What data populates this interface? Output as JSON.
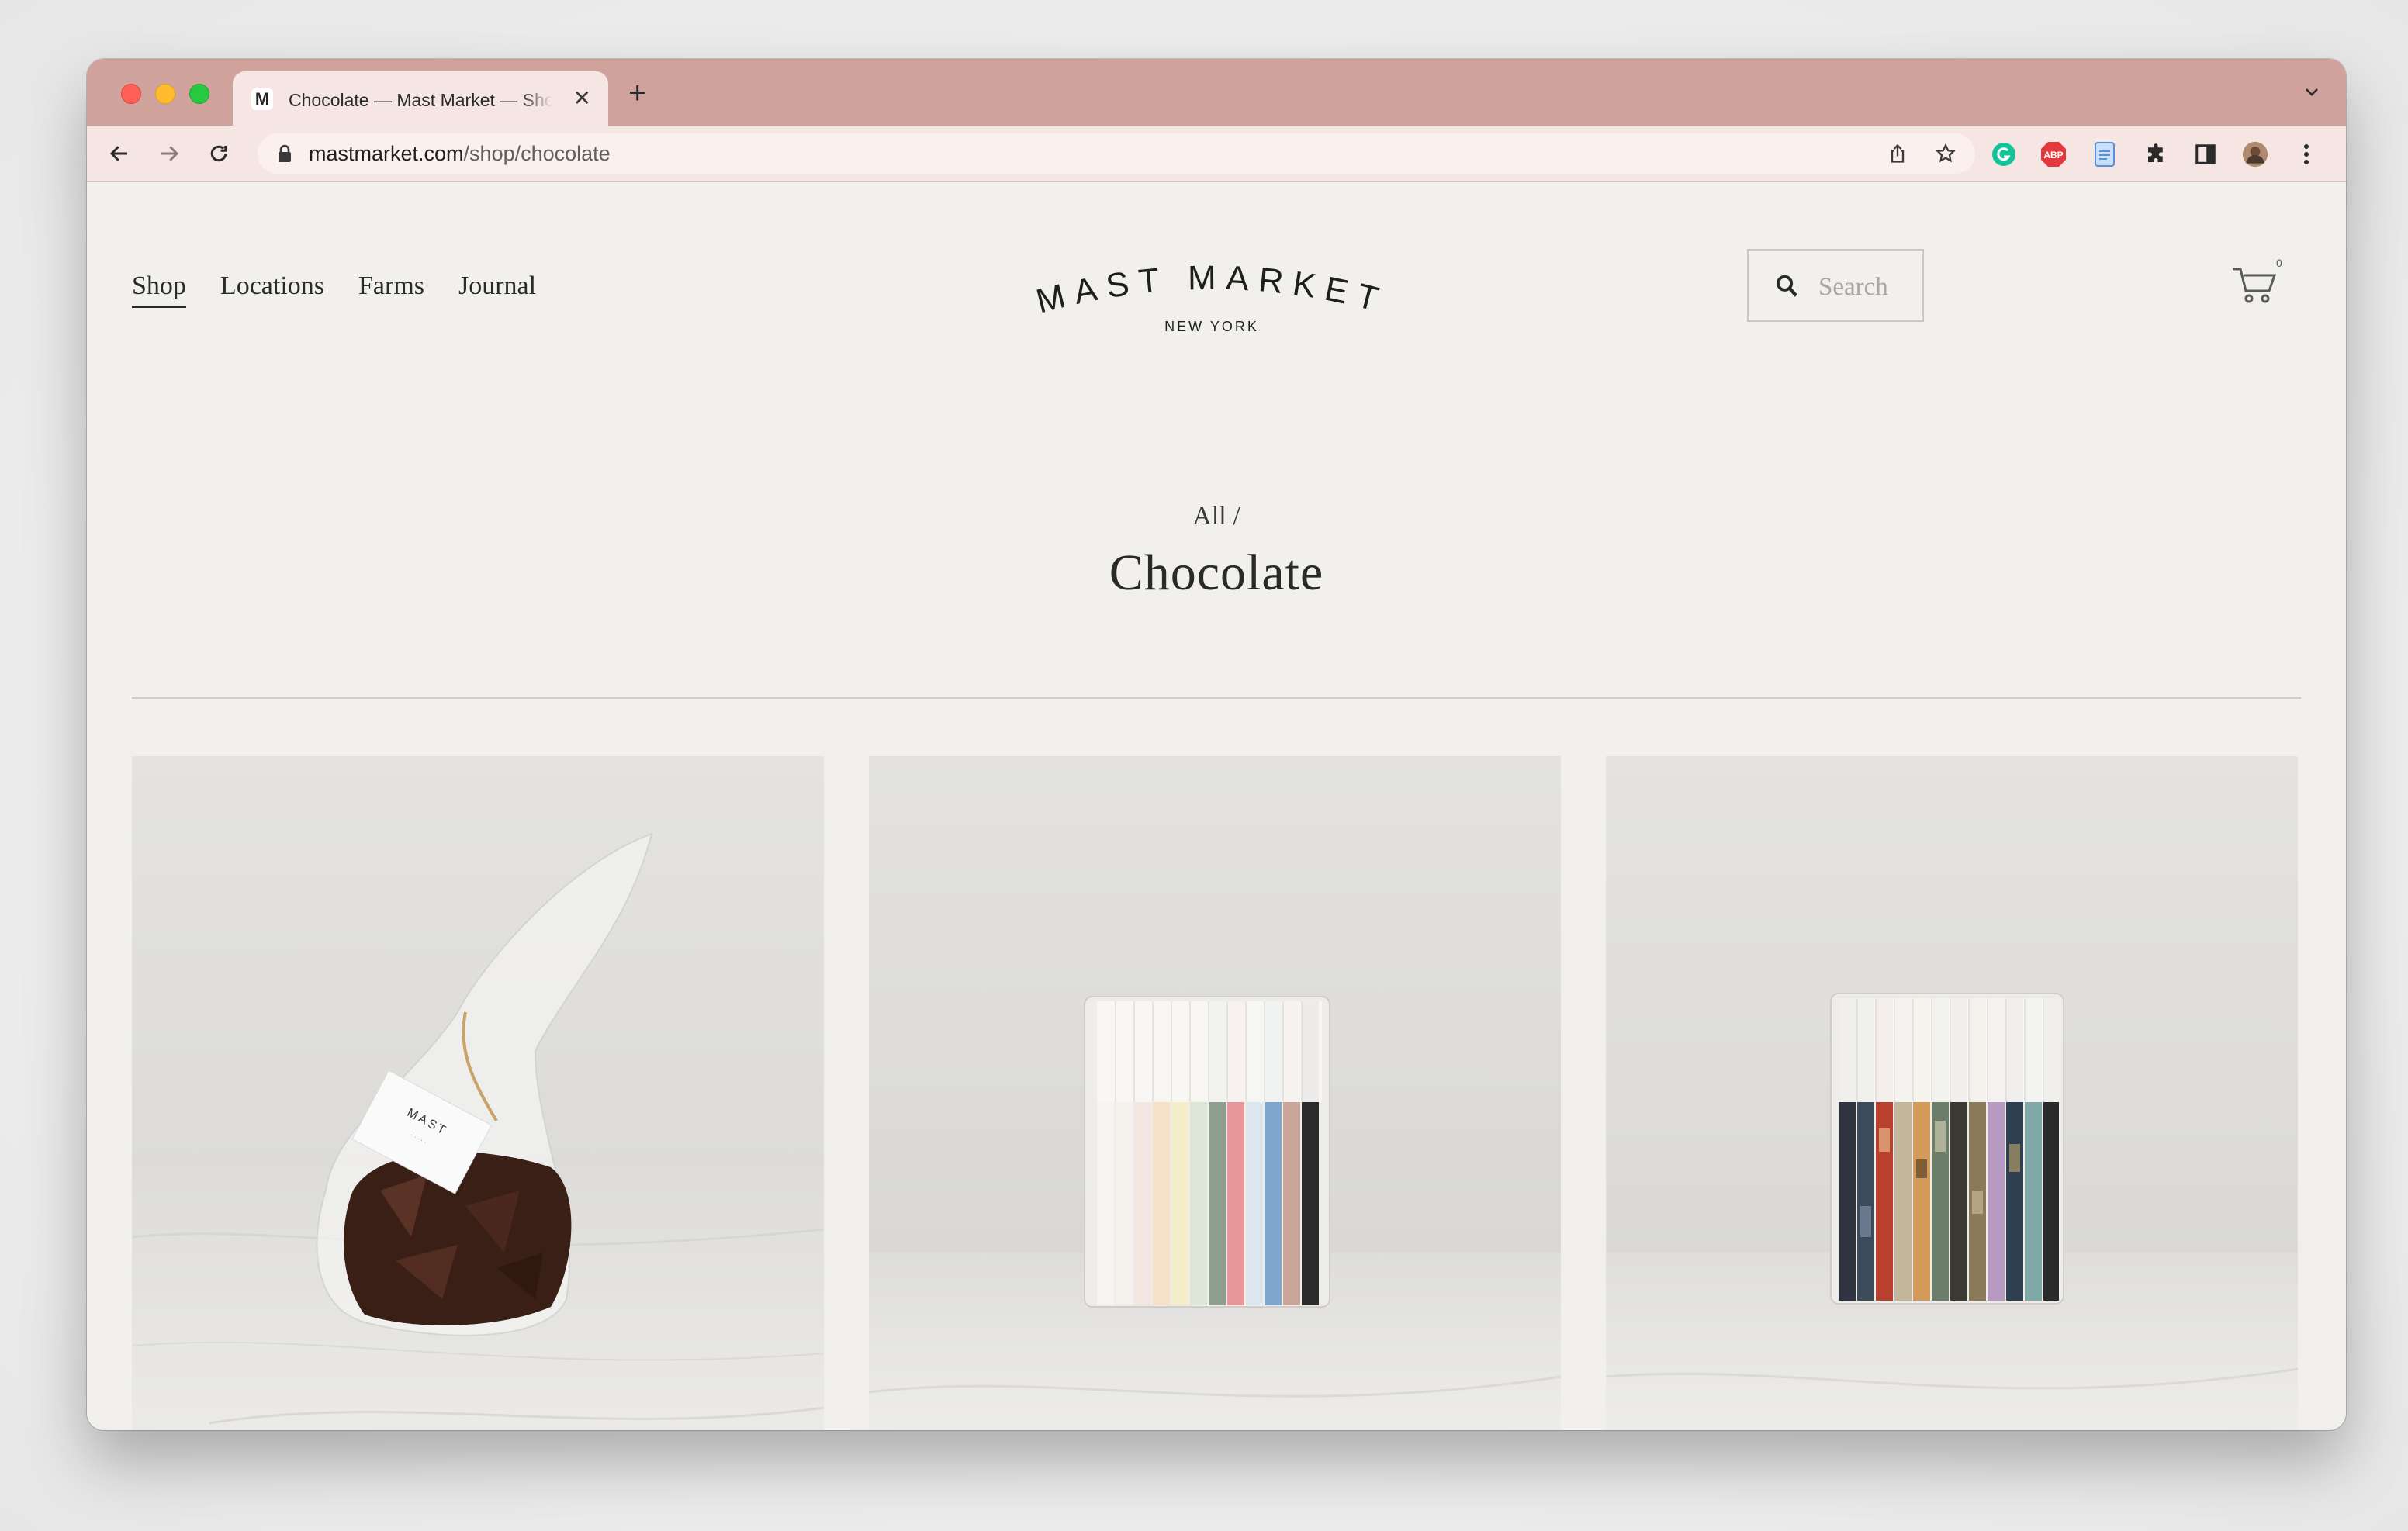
{
  "browser": {
    "tab": {
      "favicon_letter": "M",
      "title": "Chocolate — Mast Market — Shop"
    },
    "url": {
      "domain": "mastmarket.com",
      "path": "/shop/chocolate"
    },
    "theme_color": "#cfa39b"
  },
  "site": {
    "nav": [
      {
        "label": "Shop",
        "active": true
      },
      {
        "label": "Locations"
      },
      {
        "label": "Farms"
      },
      {
        "label": "Journal"
      }
    ],
    "logo": {
      "name": "MAST MARKET",
      "subtitle": "NEW YORK"
    },
    "search": {
      "placeholder": "Search"
    },
    "cart": {
      "count": "0"
    }
  },
  "main": {
    "breadcrumb": "All /",
    "title": "Chocolate",
    "products": [
      {
        "image": "chocolate-bark-bag"
      },
      {
        "image": "pastel-chocolate-bar-set"
      },
      {
        "image": "patterned-chocolate-bar-set"
      }
    ]
  }
}
